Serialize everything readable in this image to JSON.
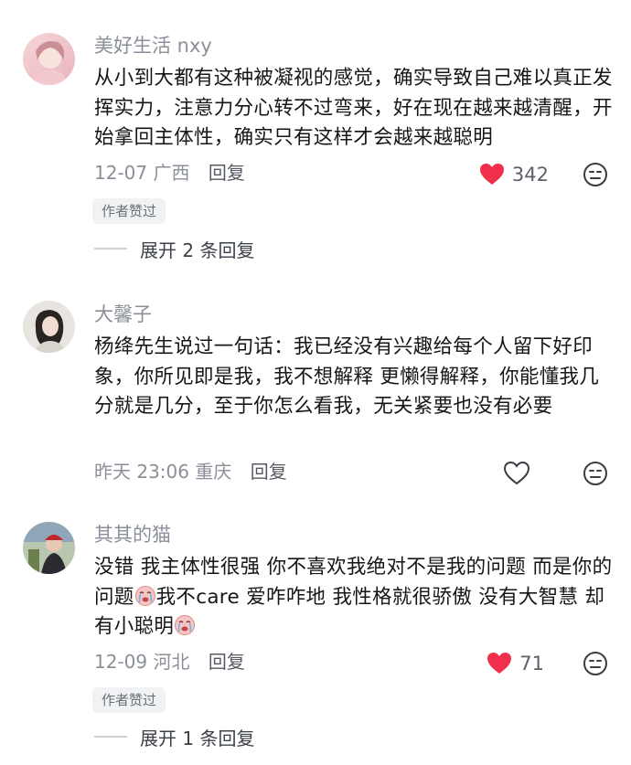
{
  "comments": [
    {
      "username": "美好生活 nxy",
      "text": "从小到大都有这种被凝视的感觉，确实导致自己难以真正发挥实力，注意力分心转不过弯来，好在现在越来越清醒，开始拿回主体性，确实只有这样才会越来越聪明",
      "date": "12-07",
      "location": "广西",
      "reply_label": "回复",
      "like_count": "342",
      "liked": true,
      "badge": "作者赞过",
      "expand_label": "展开 2 条回复"
    },
    {
      "username": "大馨子",
      "text": "杨绛先生说过一句话：我已经没有兴趣给每个人留下好印象，你所见即是我，我不想解释 更懒得解释，你能懂我几分就是几分，至于你怎么看我，无关紧要也没有必要",
      "date": "昨天 23:06",
      "location": "重庆",
      "reply_label": "回复",
      "like_count": "",
      "liked": false
    },
    {
      "username": "其其的猫",
      "text_part1": "没错 我主体性很强 你不喜欢我绝对不是我的问题 而是你的问题",
      "text_part2": "我不care 爱咋咋地 我性格就很骄傲 没有大智慧 却有小聪明",
      "date": "12-09",
      "location": "河北",
      "reply_label": "回复",
      "like_count": "71",
      "liked": true,
      "badge": "作者赞过",
      "expand_label": "展开 1 条回复"
    }
  ],
  "colors": {
    "like_red": "#f0304b",
    "meta_gray": "#8a8f99"
  },
  "icons": [
    "heart-icon",
    "dislike-face-icon",
    "crying-emoji-icon"
  ]
}
